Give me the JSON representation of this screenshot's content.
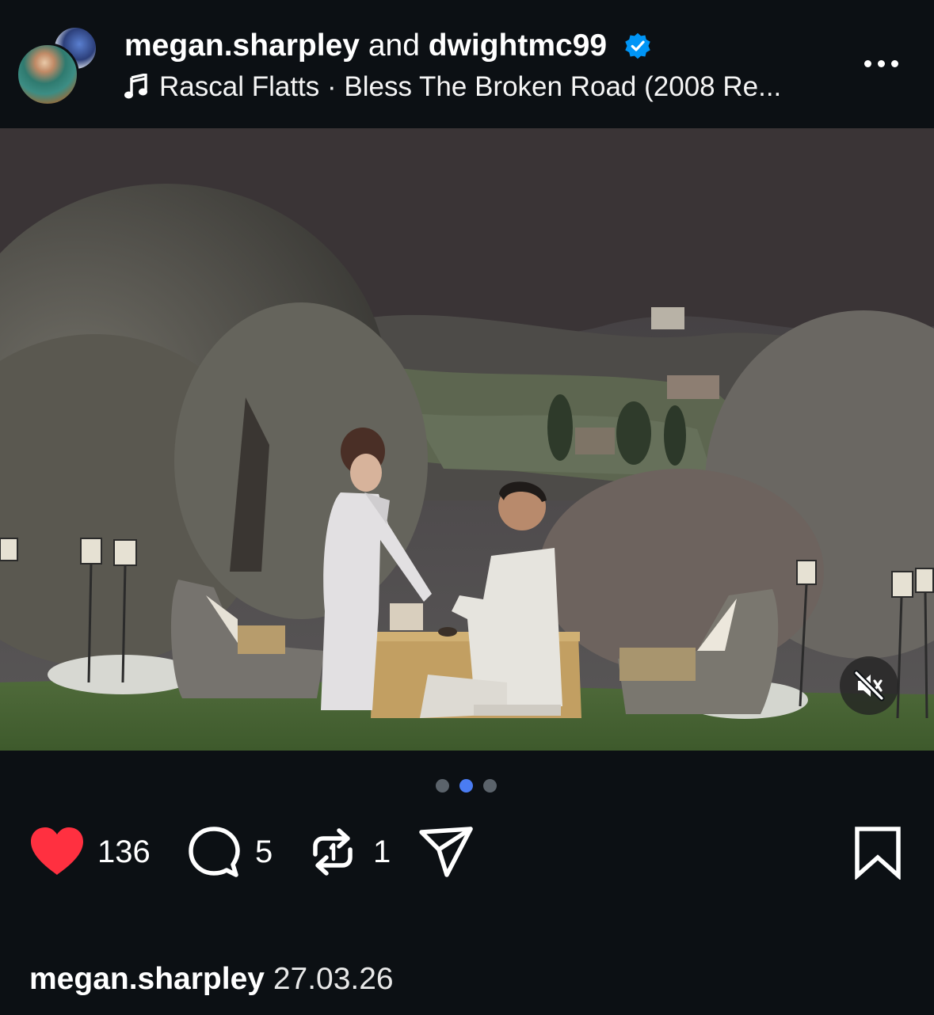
{
  "header": {
    "user1": "megan.sharpley",
    "conjunction": "and",
    "user2": "dwightmc99",
    "music": "Rascal Flatts · Bless The Broken Road (2008 Re...",
    "more_icon": "more-horizontal-icon",
    "verified_icon": "verified-badge-icon",
    "music_icon": "music-note-icon"
  },
  "media": {
    "mute_icon": "speaker-muted-icon",
    "carousel": {
      "total": 3,
      "active": 2
    }
  },
  "actions": {
    "likes": "136",
    "comments": "5",
    "reposts": "1",
    "like_icon": "heart-filled-icon",
    "comment_icon": "comment-bubble-icon",
    "repost_icon": "repost-icon",
    "share_icon": "send-icon",
    "save_icon": "bookmark-icon"
  },
  "caption": {
    "username": "megan.sharpley",
    "date": "27.03.26"
  },
  "colors": {
    "background": "#0c1014",
    "like_red": "#ff3040",
    "verified_blue": "#0095f6",
    "dot_active": "#4a7cf2",
    "dot_inactive": "#5b636b"
  }
}
